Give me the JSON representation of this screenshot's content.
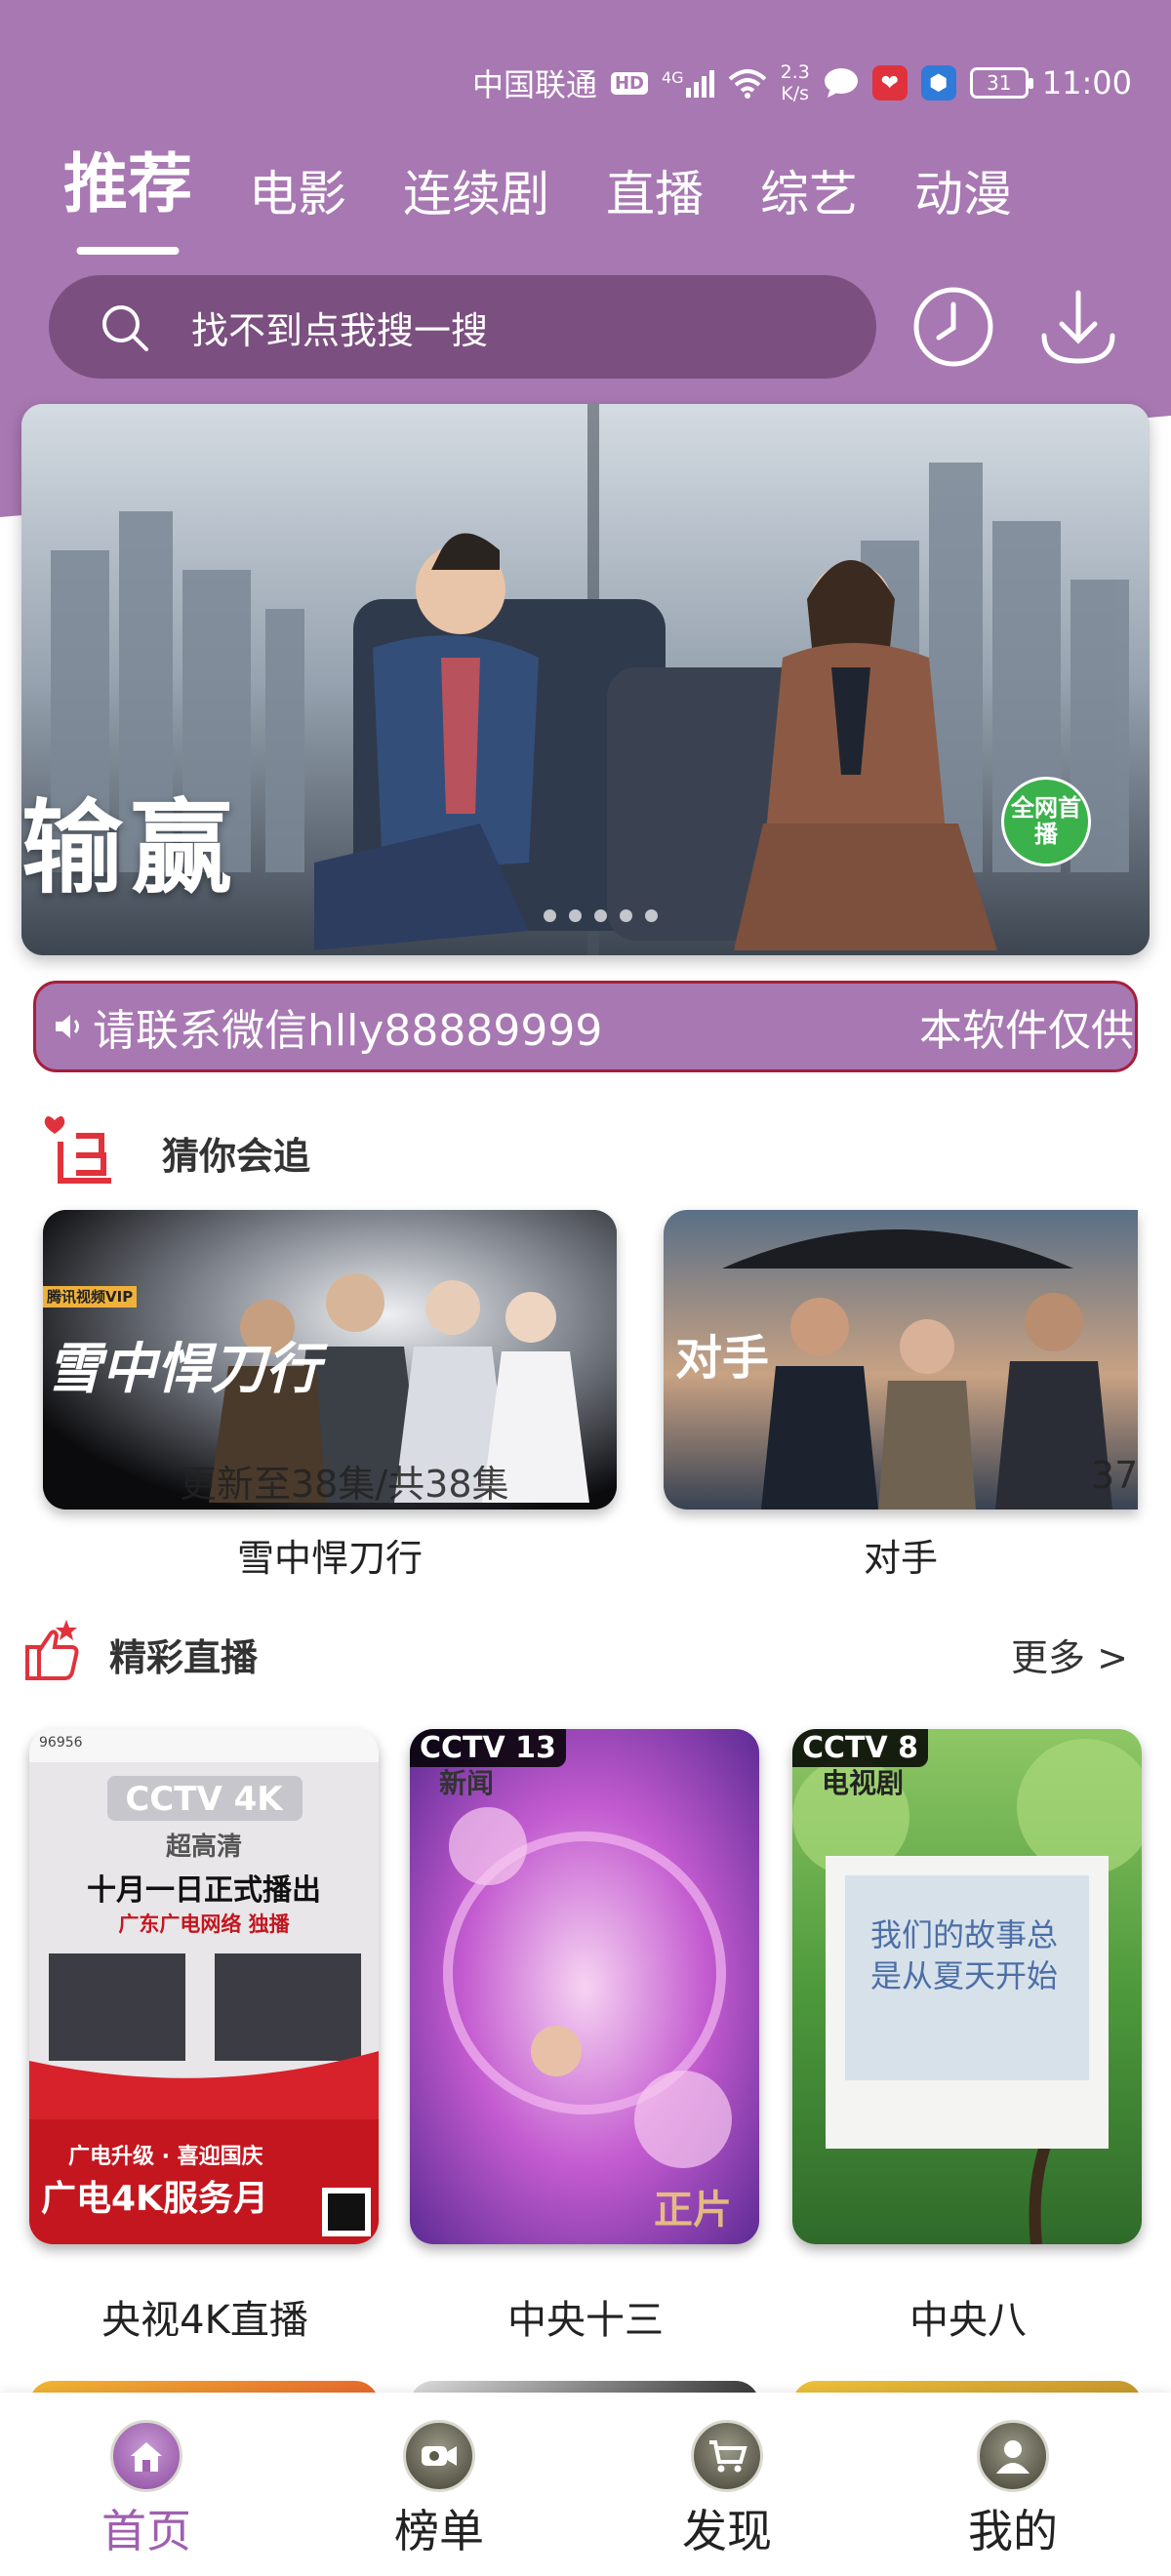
{
  "status_bar": {
    "carrier": "中国联通",
    "hd": "HD",
    "network": "4G",
    "speed": "2.3\nK/s",
    "battery": "31",
    "time": "11:00"
  },
  "tabs": [
    {
      "label": "推荐",
      "active": true
    },
    {
      "label": "电影",
      "active": false
    },
    {
      "label": "连续剧",
      "active": false
    },
    {
      "label": "直播",
      "active": false
    },
    {
      "label": "综艺",
      "active": false
    },
    {
      "label": "动漫",
      "active": false
    }
  ],
  "search": {
    "placeholder": "找不到点我搜一搜"
  },
  "banner": {
    "title": "输赢",
    "badge": "全网首播",
    "dots": 5
  },
  "notice": {
    "text_left": "请联系微信hlly88889999",
    "text_right": "本软件仅供"
  },
  "guess": {
    "title": "猜你会追",
    "cards": [
      {
        "title": "雪中悍刀行",
        "episodes": "更新至38集/共38集",
        "poster_text": "雪中悍刀行",
        "tag": "腾讯视频VIP"
      },
      {
        "title": "对手",
        "episodes": "37",
        "poster_text": "对手"
      }
    ]
  },
  "live": {
    "title": "精彩直播",
    "more": "更多 >",
    "cards": [
      {
        "title": "央视4K直播",
        "logo": "CCTV 4K",
        "sub": "超高清",
        "headline": "十月一日正式播出",
        "line2": "广东广电网络 独播",
        "footer1": "广电升级 · 喜迎国庆",
        "footer2": "广电4K服务月",
        "tag": "96956"
      },
      {
        "title": "中央十三",
        "logo": "CCTV 13",
        "sub": "新闻",
        "corner": "正片"
      },
      {
        "title": "中央八",
        "logo": "CCTV 8",
        "sub": "电视剧",
        "note": "我们的故事总是从夏天开始"
      }
    ]
  },
  "bottom_nav": [
    {
      "label": "首页",
      "icon": "home-icon",
      "active": true
    },
    {
      "label": "榜单",
      "icon": "video-camera-icon",
      "active": false
    },
    {
      "label": "发现",
      "icon": "cart-icon",
      "active": false
    },
    {
      "label": "我的",
      "icon": "user-icon",
      "active": false
    }
  ],
  "colors": {
    "primary": "#a878b2",
    "search_bg": "#7b4f7f",
    "notice_border": "#a51f3a",
    "accent_red": "#e0323c"
  }
}
